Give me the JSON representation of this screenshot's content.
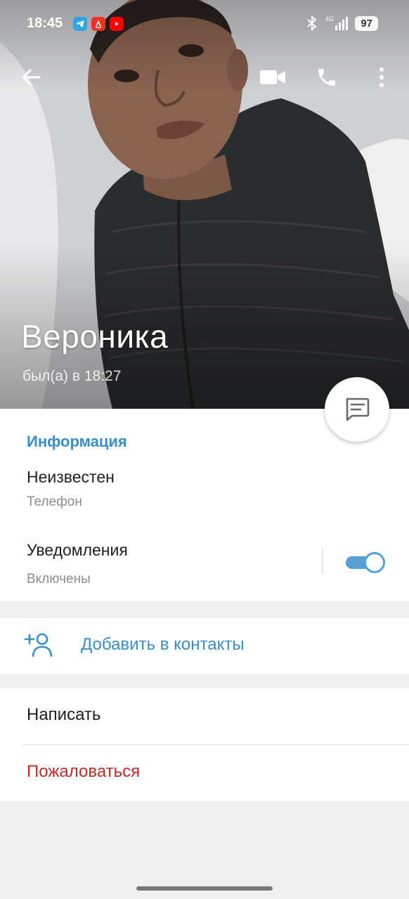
{
  "status_bar": {
    "time": "18:45",
    "battery": "97",
    "network": "4G"
  },
  "profile": {
    "name": "Вероника",
    "last_seen": "был(а) в 18:27"
  },
  "info": {
    "section_title": "Информация",
    "phone_value": "Неизвестен",
    "phone_label": "Телефон",
    "notifications_label": "Уведомления",
    "notifications_state": "Включены",
    "notifications_enabled": true
  },
  "actions": {
    "add_contact": "Добавить в контакты",
    "write": "Написать",
    "report": "Пожаловаться"
  },
  "colors": {
    "accent": "#3a8ec7",
    "danger": "#c62828",
    "toggle": "#55a0d6"
  }
}
